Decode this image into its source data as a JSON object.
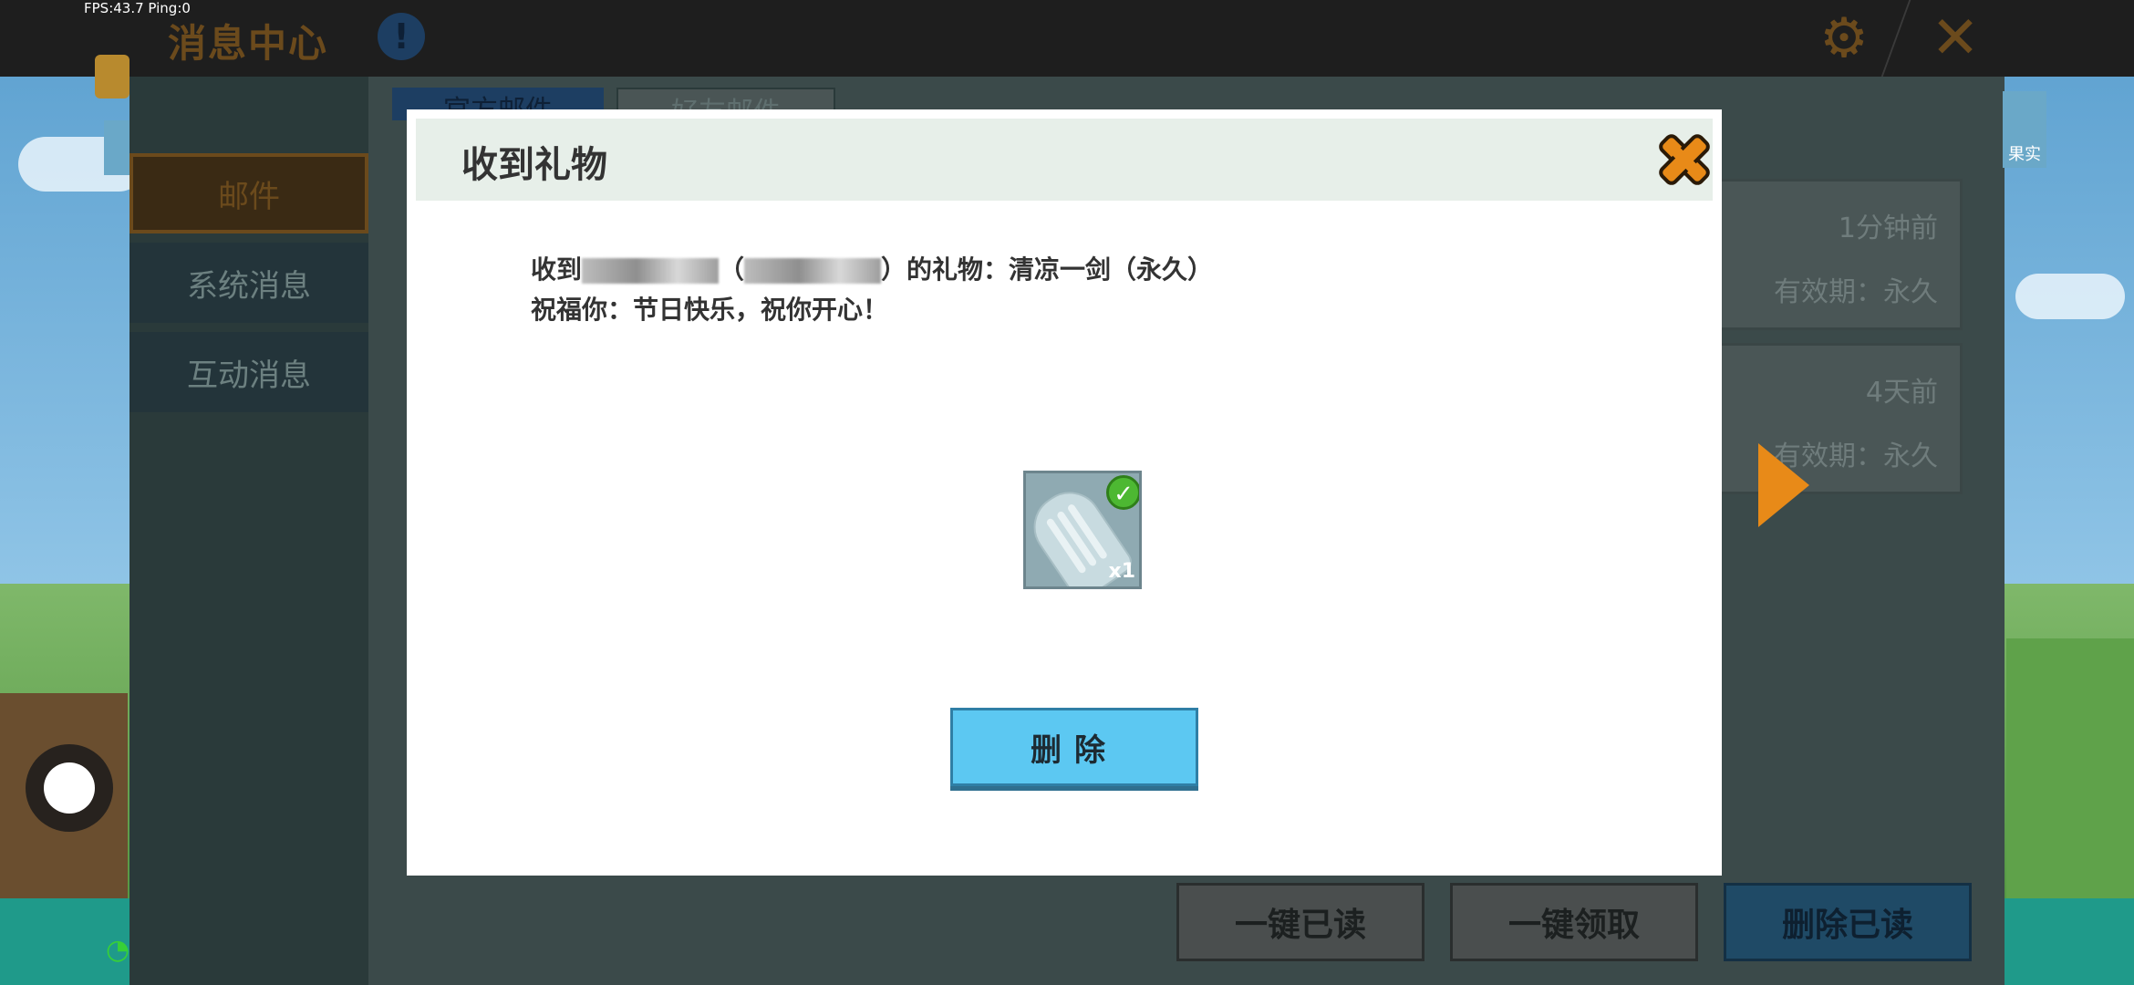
{
  "status": {
    "fps": "FPS:43.7  Ping:0"
  },
  "header": {
    "title": "消息中心"
  },
  "sidebar": {
    "items": [
      {
        "label": "邮件"
      },
      {
        "label": "系统消息"
      },
      {
        "label": "互动消息"
      }
    ]
  },
  "tabs": [
    {
      "label": "官方邮件"
    },
    {
      "label": "好友邮件"
    }
  ],
  "mail_list": [
    {
      "time": "1分钟前",
      "expiry": "有效期：永久"
    },
    {
      "time": "4天前",
      "expiry": "有效期：永久"
    }
  ],
  "bottom_buttons": {
    "read_all": "一键已读",
    "claim_all": "一键领取",
    "delete_read": "删除已读"
  },
  "right_side": {
    "buy_label": "果实"
  },
  "dialog": {
    "title": "收到礼物",
    "line1_prefix": "收到",
    "line1_mid": "（",
    "line1_suffix": "）的礼物：清凉一剑（永久）",
    "line2": "祝福你：节日快乐，祝你开心！",
    "item_qty": "x1",
    "delete_label": "删除"
  },
  "colors": {
    "accent_orange": "#e88a18",
    "button_blue": "#5cc8f2",
    "dialog_bg": "#ffffff"
  }
}
